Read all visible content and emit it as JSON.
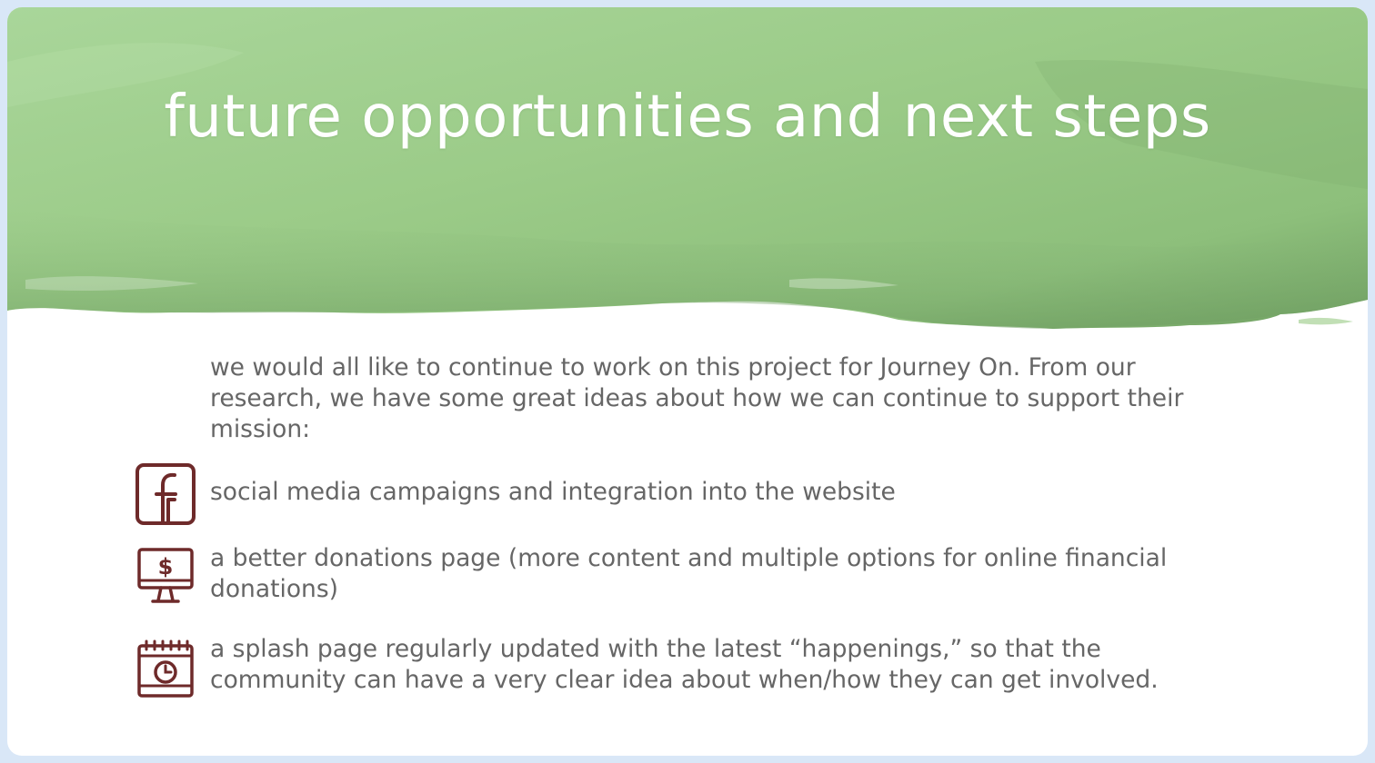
{
  "slide": {
    "title": "future opportunities and next steps",
    "intro": "we would all like to continue to work on this project for Journey On. From our research, we have some great ideas about how we can continue to support their mission:",
    "items": [
      {
        "icon": "facebook-icon",
        "text": "social media campaigns and integration into the website"
      },
      {
        "icon": "monitor-dollar-icon",
        "text": "a better donations page (more content and multiple options for online financial donations)"
      },
      {
        "icon": "calendar-clock-icon",
        "text": "a splash page regularly updated with the latest “happenings,” so that the community can have a very clear idea about when/how they can get involved."
      }
    ]
  },
  "colors": {
    "background_frame": "#d9e7f7",
    "banner_green_light": "#a7d296",
    "banner_green_mid": "#8fc27e",
    "banner_green_dark": "#6a9f5c",
    "icon": "#6e2a2a",
    "body_text": "#666666",
    "title_text": "#ffffff"
  }
}
